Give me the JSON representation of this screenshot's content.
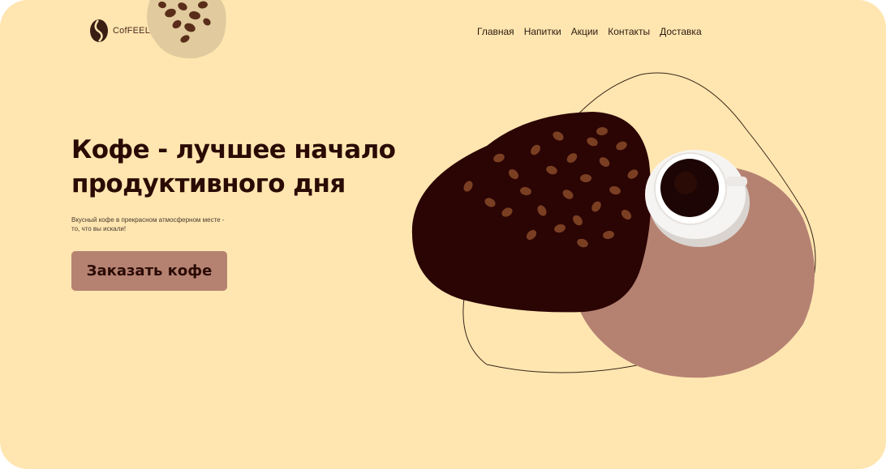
{
  "brand": {
    "name": "CofFEEL"
  },
  "nav": {
    "items": [
      {
        "label": "Главная"
      },
      {
        "label": "Напитки"
      },
      {
        "label": "Акции"
      },
      {
        "label": "Контакты"
      },
      {
        "label": "Доставка"
      }
    ]
  },
  "hero": {
    "title": "Кофе - лучшее начало продуктивного дня",
    "subtitle": "Вкусный кофе в прекрасном атмосферном месте - то, что вы искали!",
    "cta_label": "Заказать кофе"
  },
  "colors": {
    "background": "#ffe6b0",
    "dark_blob": "#2b0404",
    "pink_blob": "#b58272",
    "button": "#b58272",
    "text": "#2a0b04"
  },
  "icons": [
    "coffee-bean-logo-icon",
    "coffee-beans-image",
    "coffee-cup-image"
  ]
}
